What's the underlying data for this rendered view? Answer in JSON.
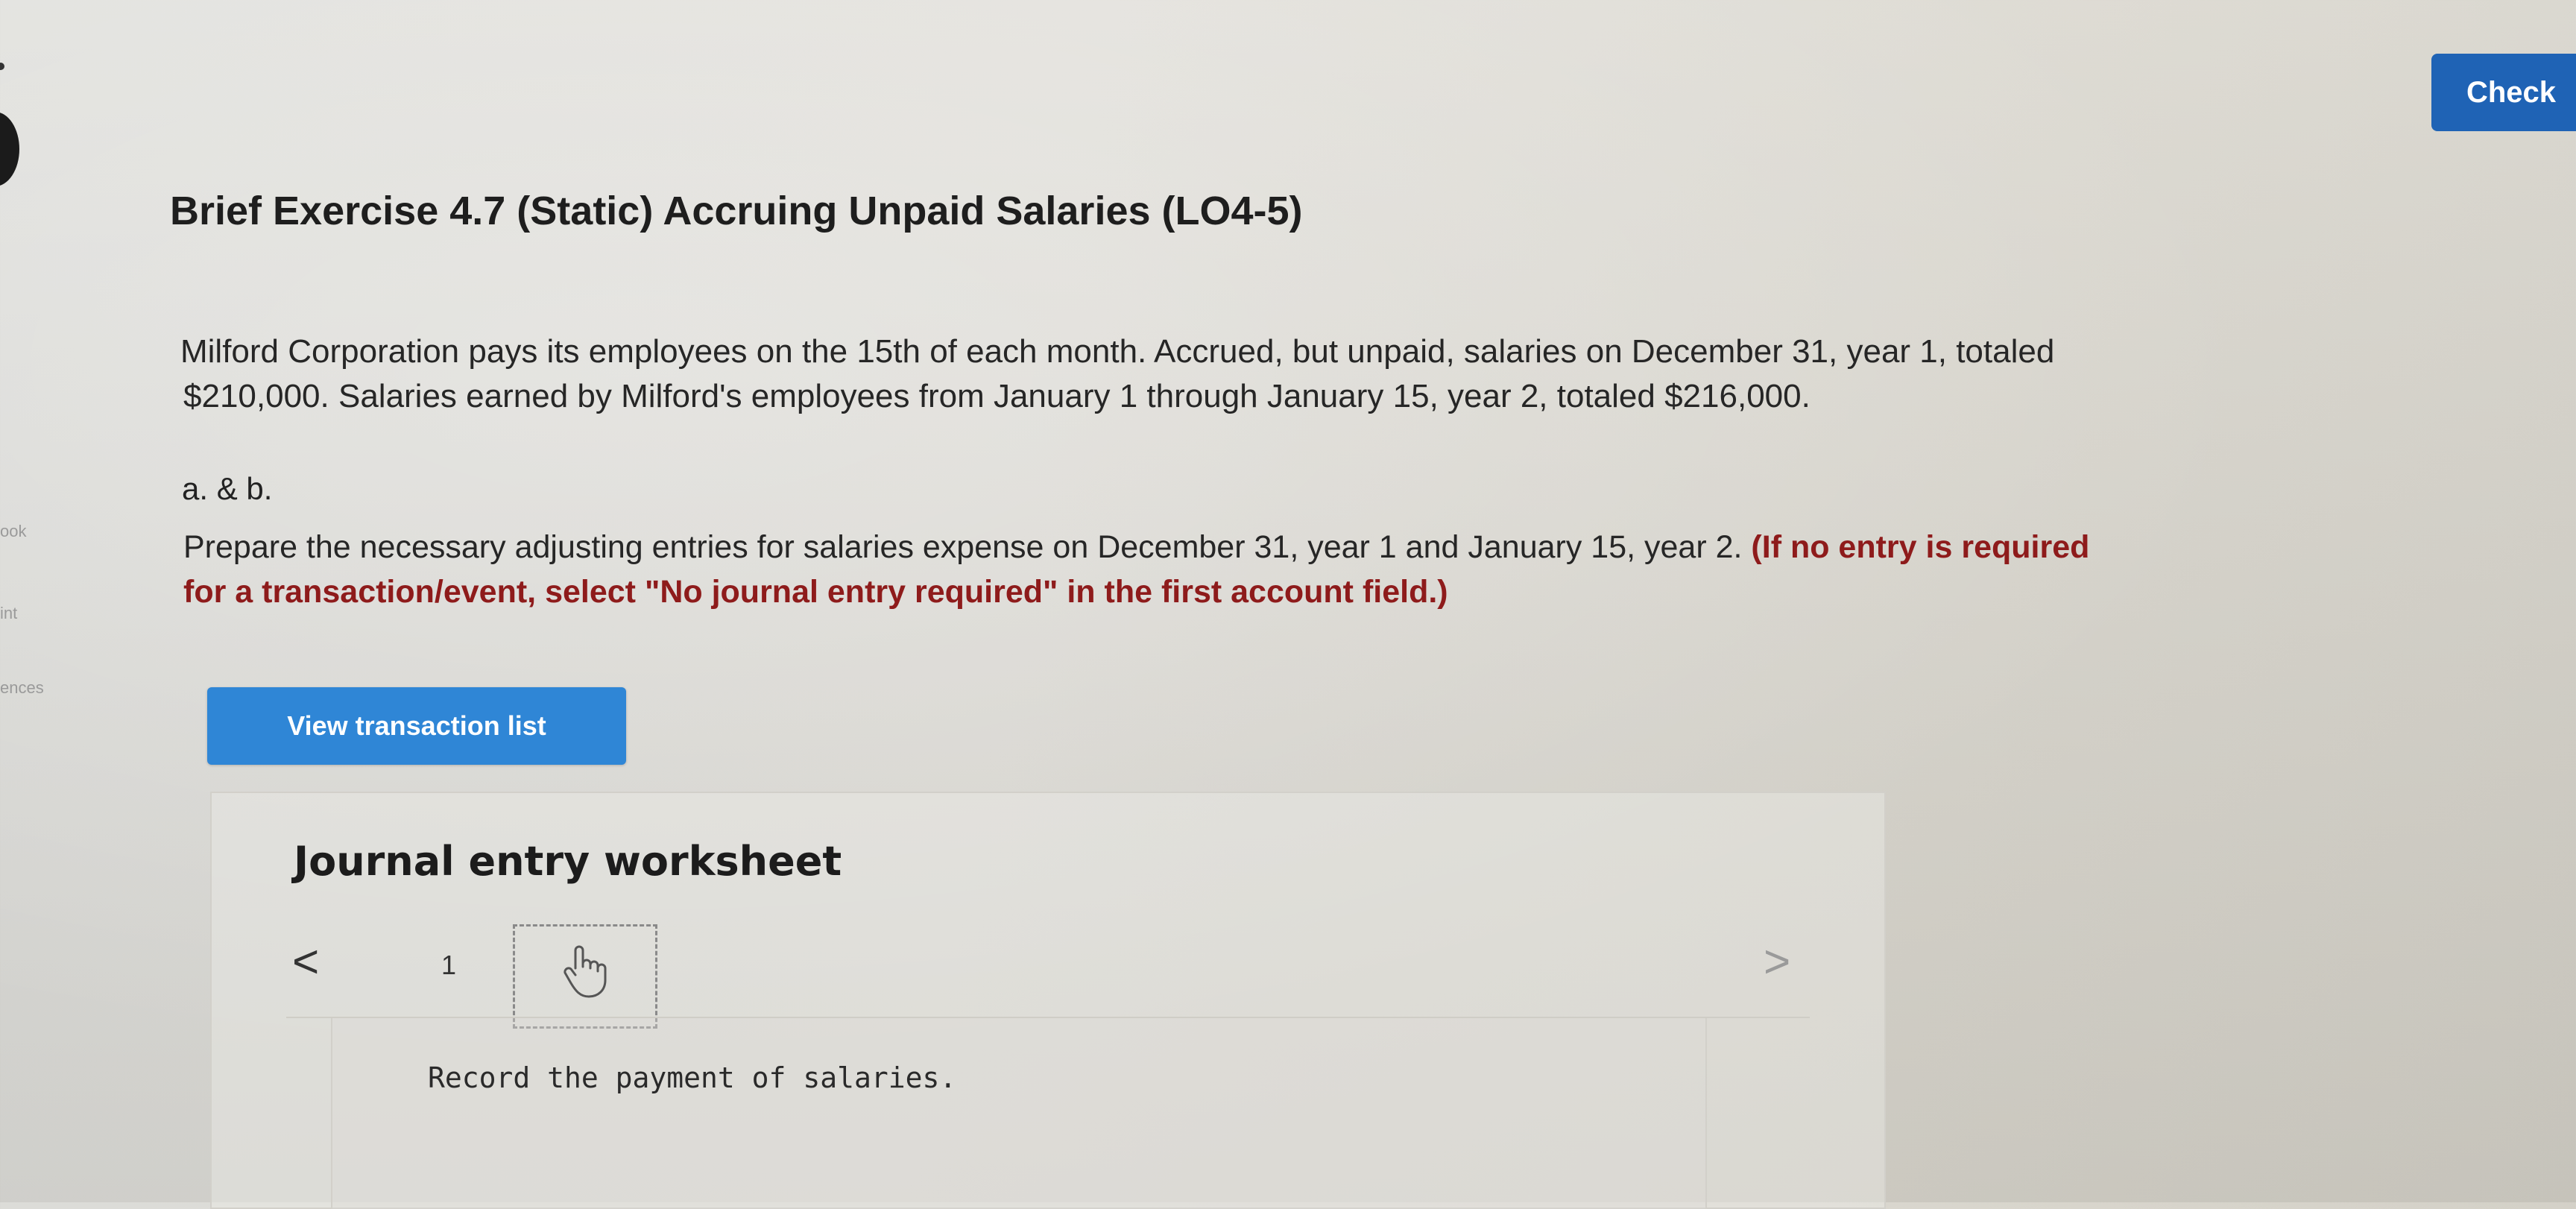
{
  "rail": {
    "items": [
      "ook",
      "int",
      "ences"
    ]
  },
  "header": {
    "check_label": "Check"
  },
  "exercise": {
    "title": "Brief Exercise 4.7 (Static) Accruing Unpaid Salaries (LO4-5)",
    "description_line1": "Milford Corporation pays its employees on the 15th of each month. Accrued, but unpaid, salaries on December 31, year 1, totaled",
    "description_line2": "$210,000. Salaries earned by Milford's employees from January 1 through January 15, year 2, totaled $216,000.",
    "part_label": "a. & b.",
    "instruction_line1": "Prepare the necessary adjusting entries for salaries expense on December 31, year 1 and January 15, year 2.",
    "instruction_note_line1": "(If no entry is required",
    "instruction_note_line2": "for a transaction/event, select \"No journal entry required\" in the first account field.)"
  },
  "actions": {
    "view_transactions_label": "View transaction list"
  },
  "worksheet": {
    "title": "Journal entry worksheet",
    "prev_symbol": "<",
    "next_symbol": ">",
    "current_page": "1",
    "next_page_icon": "hand-pointer-icon",
    "instruction": "Record the payment of salaries."
  }
}
